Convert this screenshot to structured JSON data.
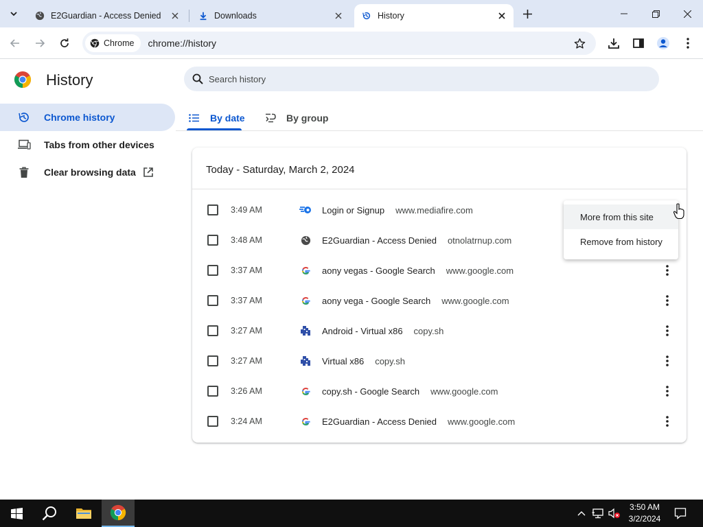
{
  "colors": {
    "accent": "#0b57d0",
    "tabstrip_bg": "#dfe7f5",
    "omnibox_bg": "#eef2f9",
    "active_nav_bg": "#dde6f6",
    "taskbar_bg": "#101010"
  },
  "tabs": [
    {
      "title": "E2Guardian - Access Denied",
      "icon": "globe-icon",
      "active": false
    },
    {
      "title": "Downloads",
      "icon": "download-icon",
      "active": false
    },
    {
      "title": "History",
      "icon": "history-icon",
      "active": true
    }
  ],
  "toolbar": {
    "site_chip_label": "Chrome",
    "url": "chrome://history"
  },
  "page": {
    "title": "History",
    "search_placeholder": "Search history"
  },
  "sidebar": {
    "items": [
      {
        "label": "Chrome history",
        "icon": "history-icon",
        "active": true
      },
      {
        "label": "Tabs from other devices",
        "icon": "devices-icon",
        "active": false
      },
      {
        "label": "Clear browsing data",
        "icon": "trash-icon",
        "active": false,
        "external": true
      }
    ]
  },
  "view_tabs": [
    {
      "label": "By date",
      "icon": "list-icon",
      "active": true
    },
    {
      "label": "By group",
      "icon": "group-icon",
      "active": false
    }
  ],
  "history": {
    "date_header": "Today - Saturday, March 2, 2024",
    "entries": [
      {
        "time": "3:49 AM",
        "title": "Login or Signup",
        "domain": "www.mediafire.com",
        "icon": "mediafire-icon"
      },
      {
        "time": "3:48 AM",
        "title": "E2Guardian - Access Denied",
        "domain": "otnolatrnup.com",
        "icon": "globe-icon"
      },
      {
        "time": "3:37 AM",
        "title": "aony vegas - Google Search",
        "domain": "www.google.com",
        "icon": "google-icon"
      },
      {
        "time": "3:37 AM",
        "title": "aony vega - Google Search",
        "domain": "www.google.com",
        "icon": "google-icon"
      },
      {
        "time": "3:27 AM",
        "title": "Android - Virtual x86",
        "domain": "copy.sh",
        "icon": "copysh-icon"
      },
      {
        "time": "3:27 AM",
        "title": "Virtual x86",
        "domain": "copy.sh",
        "icon": "copysh-icon"
      },
      {
        "time": "3:26 AM",
        "title": "copy.sh - Google Search",
        "domain": "www.google.com",
        "icon": "google-icon"
      },
      {
        "time": "3:24 AM",
        "title": "E2Guardian - Access Denied",
        "domain": "www.google.com",
        "icon": "google-icon"
      }
    ]
  },
  "context_menu": {
    "items": [
      {
        "label": "More from this site",
        "hovered": true
      },
      {
        "label": "Remove from history",
        "hovered": false
      }
    ]
  },
  "taskbar": {
    "time": "3:50 AM",
    "date": "3/2/2024"
  }
}
